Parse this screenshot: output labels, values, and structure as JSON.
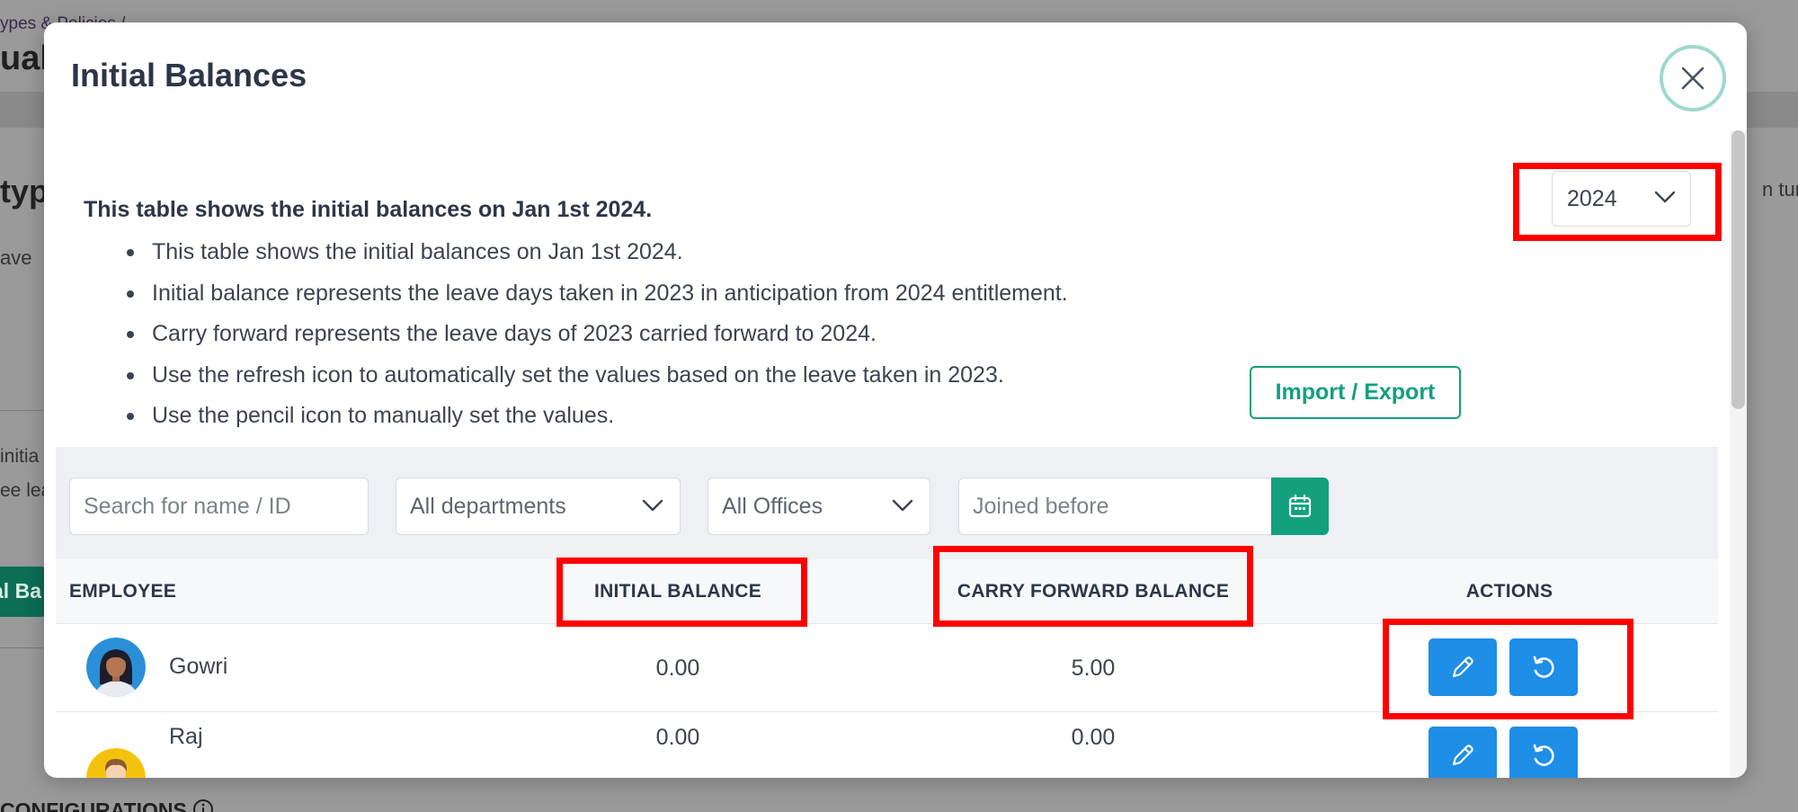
{
  "background": {
    "breadcrumb": "ypes & Policies /",
    "title": "ual",
    "section_heading": "typ",
    "subtext": "ave",
    "right_fragment": "n turn",
    "initial_fragment": "initia",
    "leave_fragment": "ee lea",
    "button_fragment": "al Ba",
    "configurations": "CONFIGURATIONS"
  },
  "modal": {
    "title": "Initial Balances",
    "info_heading": "This table shows the initial balances on Jan 1st 2024.",
    "bullets": [
      "This table shows the initial balances on Jan 1st 2024.",
      "Initial balance represents the leave days taken in 2023 in anticipation from 2024 entitlement.",
      "Carry forward represents the leave days of 2023 carried forward to 2024.",
      "Use the refresh icon to automatically set the values based on the leave taken in 2023.",
      "Use the pencil icon to manually set the values."
    ],
    "year_select": {
      "value": "2024"
    },
    "import_export_label": "Import / Export"
  },
  "filters": {
    "search_placeholder": "Search for name / ID",
    "department": "All departments",
    "office": "All Offices",
    "joined_placeholder": "Joined before"
  },
  "table": {
    "headers": {
      "employee": "EMPLOYEE",
      "initial_balance": "INITIAL BALANCE",
      "carry_forward_balance": "CARRY FORWARD BALANCE",
      "actions": "ACTIONS"
    },
    "rows": [
      {
        "name": "Gowri",
        "initial_balance": "0.00",
        "carry_forward_balance": "5.00"
      },
      {
        "name": "Raj",
        "initial_balance": "0.00",
        "carry_forward_balance": "0.00"
      }
    ]
  },
  "colors": {
    "accent_green": "#12a07d",
    "action_blue": "#1e8ee6",
    "highlight_red": "#ff0000",
    "close_ring": "#9fd8cd"
  }
}
